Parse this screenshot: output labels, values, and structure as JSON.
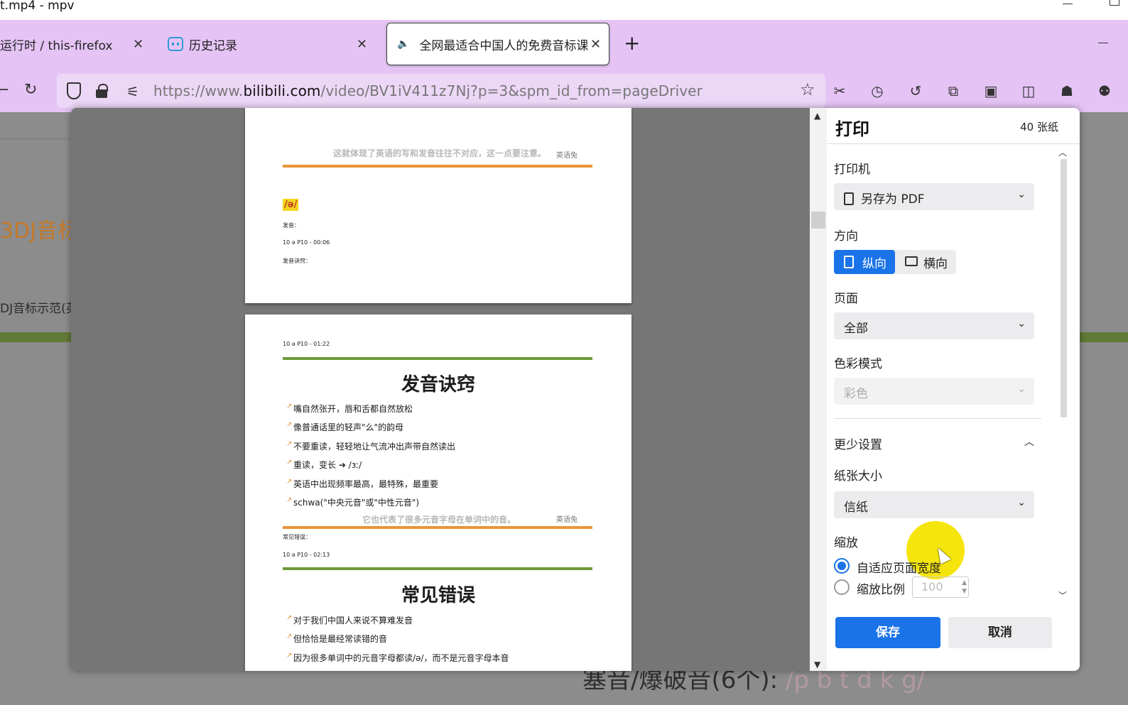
{
  "window": {
    "title": "t.mp4 - mpv"
  },
  "tabs": [
    {
      "label": "运行时 / this-firefox",
      "close": "✕"
    },
    {
      "label": "历史记录",
      "close": "✕",
      "icon": "bilibili-icon"
    },
    {
      "label": "全网最适合中国人的免费音标课",
      "close": "✕",
      "icon": "speaker-icon",
      "active": true
    }
  ],
  "newtab_label": "+",
  "navbar": {
    "url_prefix": "https://www.",
    "url_domain": "bilibili.com",
    "url_path": "/video/BV1iV411z7Nj?p=3&spm_id_from=pageDriver",
    "reload_glyph": "↻",
    "back_glyph": "←",
    "toolbar_icons": [
      "screenshot-icon",
      "history-icon",
      "undo-clock-icon",
      "extensions-icon",
      "container-icon",
      "reader-view-icon",
      "addon-avatar-icon",
      "account-icon"
    ]
  },
  "background_page": {
    "orange_text": "3DJ音标",
    "gray_text": "DJ音标示范(英",
    "bottom_text": "塞音/爆破音(6个): ",
    "bottom_ipa": "/p b t d k g/"
  },
  "print": {
    "title": "打印",
    "sheets": "40 张纸",
    "printer_label": "打印机",
    "printer_value": "另存为 PDF",
    "orientation_label": "方向",
    "portrait": "纵向",
    "landscape": "横向",
    "pages_label": "页面",
    "pages_value": "全部",
    "color_label": "色彩模式",
    "color_value": "彩色",
    "less_settings": "更少设置",
    "paper_label": "纸张大小",
    "paper_value": "信纸",
    "scale_label": "缩放",
    "fit_width": "自适应页面宽度",
    "scale_ratio": "缩放比例",
    "scale_value": "100",
    "save": "保存",
    "cancel": "取消"
  },
  "preview": {
    "page1": {
      "subtitle": "这就体现了英语的写和发音往往不对应，这一点要注意。",
      "logo": "英语兔",
      "schwa": "/ə/",
      "pronounce": "发音：",
      "ts1": "10 ə P10 - 00:06",
      "tips_label": "发音诀窍："
    },
    "page2": {
      "ts2": "10 ə P10 - 01:22",
      "heading1": "发音诀窍",
      "bullets1": [
        "嘴自然张开，唇和舌都自然放松",
        "像普通话里的轻声\"么\"的韵母",
        "不要重读，轻轻地让气流冲出声带自然读出",
        "重读，变长 ➔ /ɜː/",
        "英语中出现频率最高，最特殊，最重要",
        "schwa(\"中央元音\"或\"中性元音\")"
      ],
      "subtitle2": "它也代表了很多元音字母在单词中的音。",
      "logo": "英语兔",
      "errors_label": "常见错误：",
      "ts3": "10 ə P10 - 02:13",
      "heading2": "常见错误",
      "bullets2": [
        "对于我们中国人来说不算难发音",
        "但恰恰是最经常读错的音",
        "因为很多单词中的元音字母都读/ə/，而不是元音字母本音"
      ]
    }
  }
}
